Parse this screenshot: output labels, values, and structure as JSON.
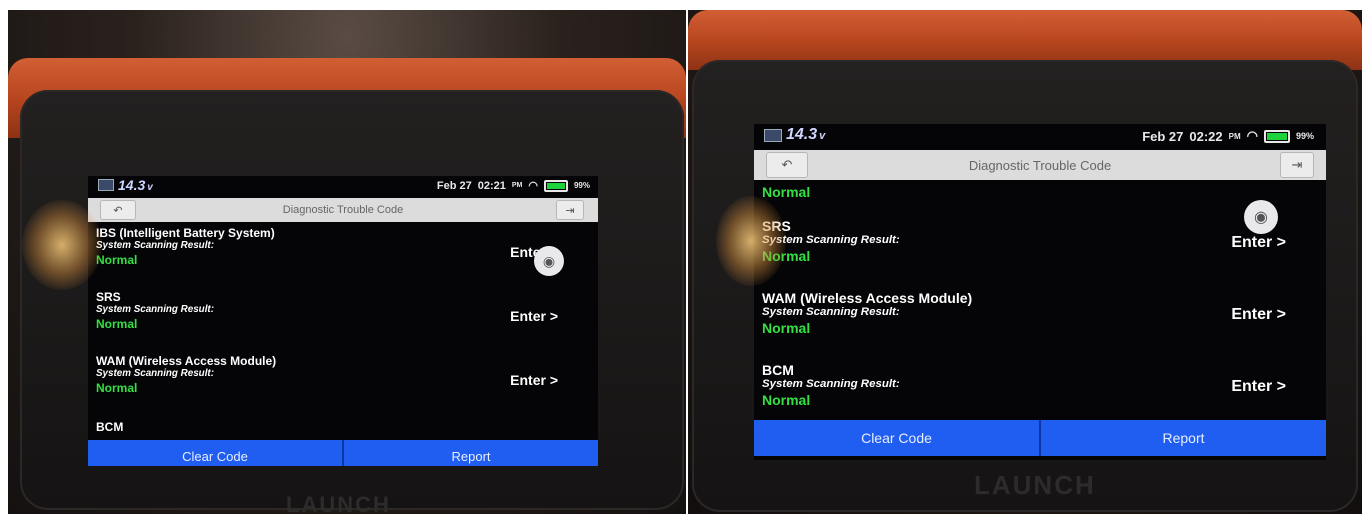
{
  "screens": [
    {
      "status": {
        "voltage": "14.3",
        "voltage_unit": "v",
        "date": "Feb 27",
        "time": "02:21",
        "ampm": "PM",
        "wifi_icon": "wifi-icon",
        "battery": "99%",
        "battery_level": 0.99
      },
      "title": "Diagnostic Trouble Code",
      "rows": [
        {
          "name": "IBS (Intelligent Battery System)",
          "label": "System Scanning Result:",
          "status": "Normal",
          "enter": "Enter >"
        },
        {
          "name": "SRS",
          "label": "System Scanning Result:",
          "status": "Normal",
          "enter": "Enter >"
        },
        {
          "name": "WAM (Wireless Access Module)",
          "label": "System Scanning Result:",
          "status": "Normal",
          "enter": "Enter >"
        },
        {
          "name": "BCM",
          "label": "",
          "status": "",
          "enter": ""
        }
      ],
      "buttons": {
        "clear": "Clear Code",
        "report": "Report"
      },
      "brand": "LAUNCH"
    },
    {
      "status": {
        "voltage": "14.3",
        "voltage_unit": "v",
        "date": "Feb 27",
        "time": "02:22",
        "ampm": "PM",
        "wifi_icon": "wifi-icon",
        "battery": "99%",
        "battery_level": 0.99
      },
      "title": "Diagnostic Trouble Code",
      "rows": [
        {
          "name": "",
          "label": "",
          "status": "Normal",
          "enter": ""
        },
        {
          "name": "SRS",
          "label": "System Scanning Result:",
          "status": "Normal",
          "enter": "Enter >"
        },
        {
          "name": "WAM (Wireless Access Module)",
          "label": "System Scanning Result:",
          "status": "Normal",
          "enter": "Enter >"
        },
        {
          "name": "BCM",
          "label": "System Scanning Result:",
          "status": "Normal",
          "enter": "Enter >"
        }
      ],
      "buttons": {
        "clear": "Clear Code",
        "report": "Report"
      },
      "brand": "LAUNCH"
    }
  ],
  "colors": {
    "status_normal": "#32e042",
    "button_blue": "#1f5ef0",
    "device_orange": "#c4522a"
  }
}
